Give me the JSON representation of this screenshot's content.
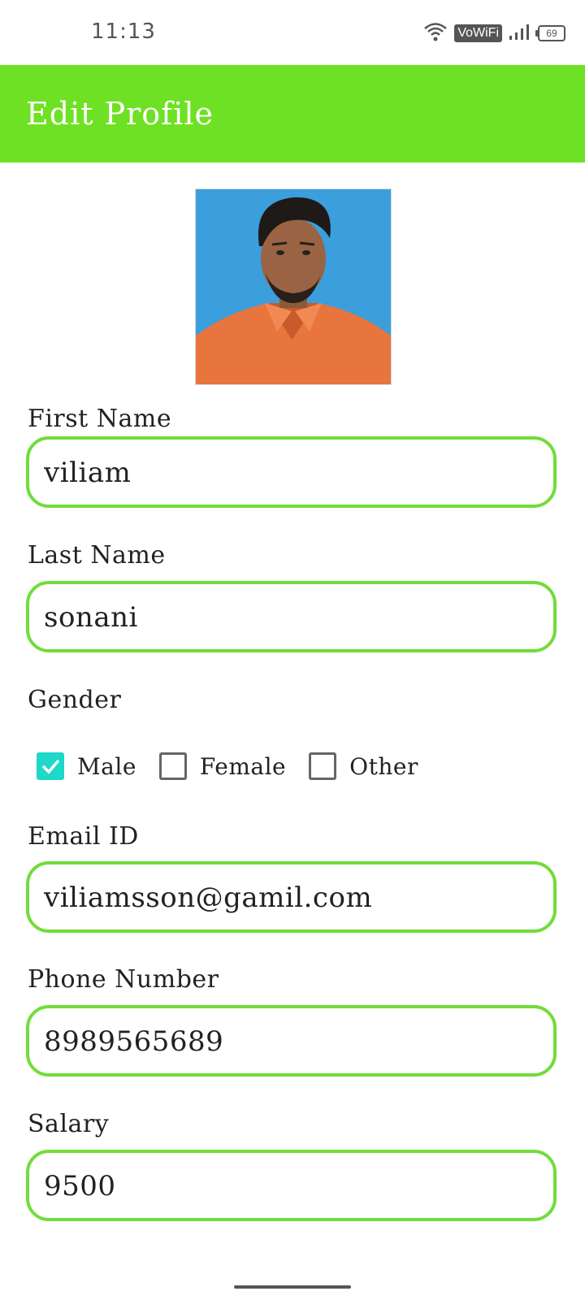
{
  "status": {
    "time": "11:13",
    "vowifi": "VoWiFi",
    "battery": "69"
  },
  "header": {
    "title": "Edit Profile"
  },
  "form": {
    "first_name": {
      "label": "First Name",
      "value": "viliam"
    },
    "last_name": {
      "label": "Last Name",
      "value": "sonani"
    },
    "gender": {
      "label": "Gender",
      "options": [
        {
          "label": "Male",
          "checked": true
        },
        {
          "label": "Female",
          "checked": false
        },
        {
          "label": "Other",
          "checked": false
        }
      ]
    },
    "email": {
      "label": "Email ID",
      "value": "viliamsson@gamil.com"
    },
    "phone": {
      "label": "Phone Number",
      "value": "8989565689"
    },
    "salary": {
      "label": "Salary",
      "value": "9500"
    }
  },
  "colors": {
    "accent": "#6fe124",
    "field_border": "#72dc3a",
    "checkbox_checked": "#1ed8c8"
  }
}
